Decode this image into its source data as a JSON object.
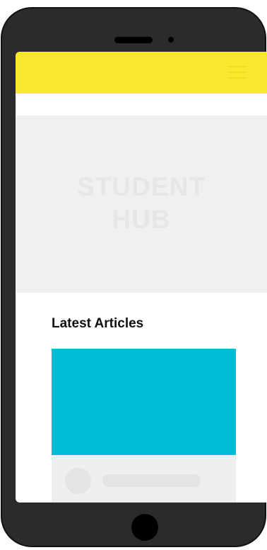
{
  "app": {
    "hero": {
      "title_line1": "STUDENT",
      "title_line2": "HUB"
    },
    "latest": {
      "heading": "Latest Articles"
    }
  },
  "colors": {
    "header_yellow": "#f9e72f",
    "article_image_cyan": "#00bcd4",
    "phone_body": "#2b2b2b",
    "placeholder_gray": "#f0f0f0"
  },
  "icons": {
    "menu": "hamburger-menu-icon"
  }
}
